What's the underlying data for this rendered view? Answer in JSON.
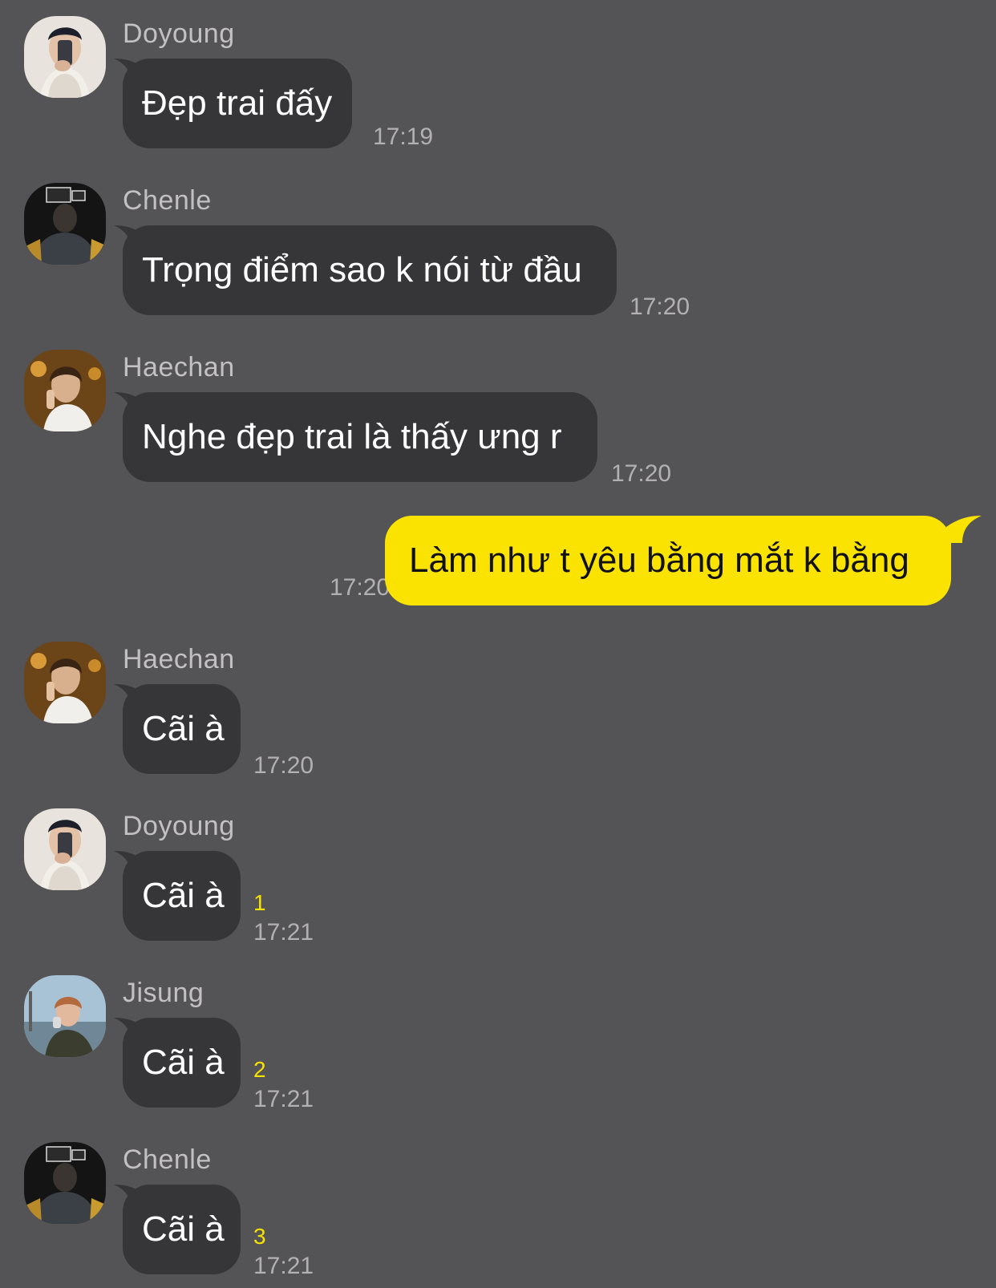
{
  "colors": {
    "background": "#545355",
    "bubble_other": "#363538",
    "bubble_me": "#fae300",
    "sender_name": "#c2c0c3",
    "timestamp": "#b2b0b4",
    "unread_count": "#f6e200"
  },
  "messages": [
    {
      "sender": "Doyoung",
      "avatar": "avatar-doyoung",
      "text": "Đẹp trai đấy",
      "time": "17:19",
      "unread": ""
    },
    {
      "sender": "Chenle",
      "avatar": "avatar-chenle",
      "text": "Trọng điểm sao k nói từ đầu",
      "time": "17:20",
      "unread": ""
    },
    {
      "sender": "Haechan",
      "avatar": "avatar-haechan",
      "text": "Nghe đẹp trai là thấy ưng r",
      "time": "17:20",
      "unread": ""
    },
    {
      "sender": "me",
      "text": "Làm như t yêu bằng mắt k bằng",
      "time": "17:20",
      "unread": ""
    },
    {
      "sender": "Haechan",
      "avatar": "avatar-haechan",
      "text": "Cãi à",
      "time": "17:20",
      "unread": ""
    },
    {
      "sender": "Doyoung",
      "avatar": "avatar-doyoung",
      "text": "Cãi à",
      "time": "17:21",
      "unread": "1"
    },
    {
      "sender": "Jisung",
      "avatar": "avatar-jisung",
      "text": "Cãi à",
      "time": "17:21",
      "unread": "2"
    },
    {
      "sender": "Chenle",
      "avatar": "avatar-chenle",
      "text": "Cãi à",
      "time": "17:21",
      "unread": "3"
    }
  ]
}
